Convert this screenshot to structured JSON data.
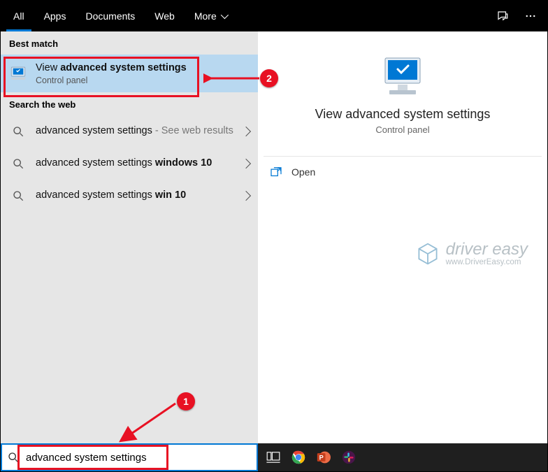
{
  "tabs": {
    "all": "All",
    "apps": "Apps",
    "documents": "Documents",
    "web": "Web",
    "more": "More"
  },
  "sections": {
    "best_match": "Best match",
    "search_web": "Search the web"
  },
  "best_match": {
    "title_pre": "View ",
    "title_bold": "advanced system settings",
    "subtitle": "Control panel"
  },
  "web_results": [
    {
      "pre": "advanced system settings",
      "suffix": " - See web results",
      "bold": ""
    },
    {
      "pre": "advanced system settings ",
      "suffix": "",
      "bold": "windows 10"
    },
    {
      "pre": "advanced system settings ",
      "suffix": "",
      "bold": "win 10"
    }
  ],
  "preview": {
    "title": "View advanced system settings",
    "subtitle": "Control panel",
    "open": "Open"
  },
  "watermark": {
    "main": "driver easy",
    "sub": "www.DriverEasy.com"
  },
  "search": {
    "value": "advanced system settings"
  },
  "badges": {
    "one": "1",
    "two": "2"
  }
}
